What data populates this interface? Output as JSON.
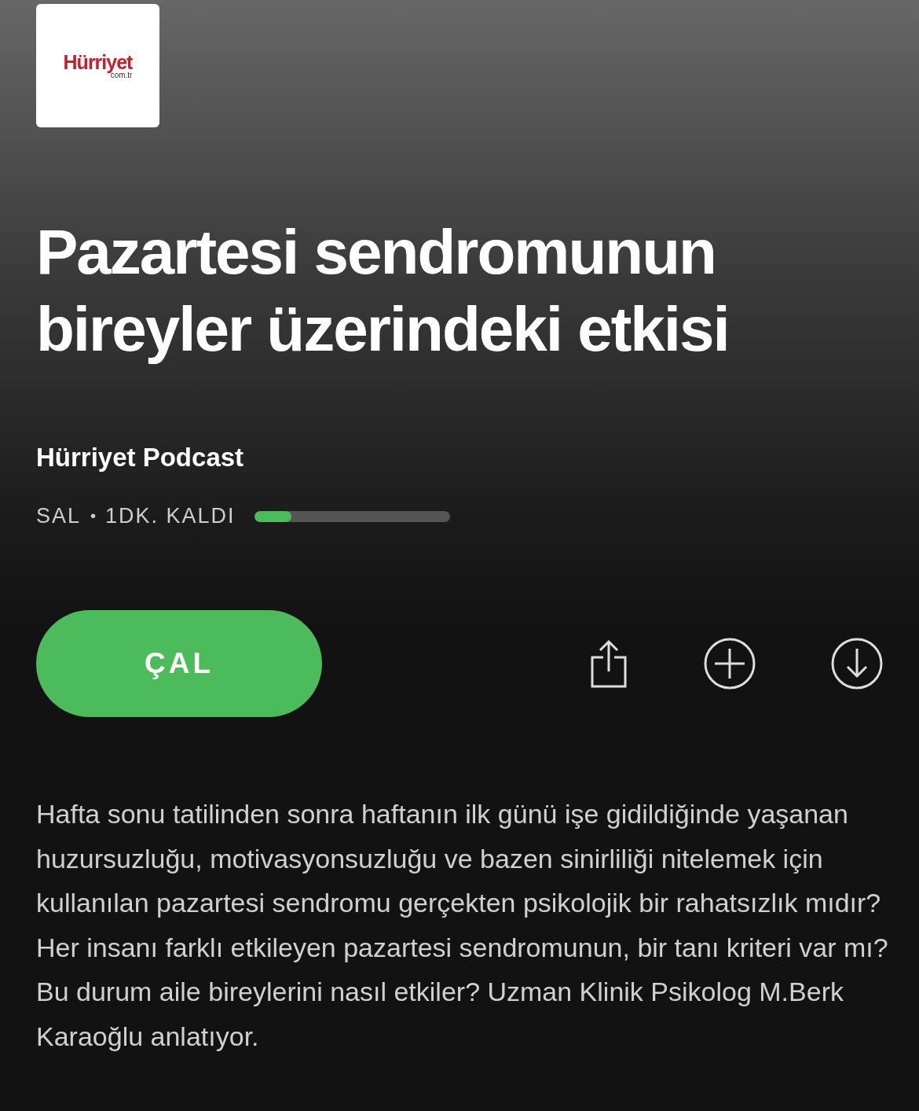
{
  "logo": {
    "name": "Hürriyet",
    "domain": "com.tr"
  },
  "episode": {
    "title": "Pazartesi sendromunun bireyler üzerindeki etkisi",
    "show": "Hürriyet Podcast",
    "day": "SAL",
    "separator": "•",
    "remaining": "1DK. KALDI",
    "progress": {
      "level": 0.19
    }
  },
  "play_button": {
    "label": "ÇAL"
  },
  "description": "Hafta sonu tatilinden sonra haftanın ilk günü işe gidildiğinde yaşanan huzursuzluğu, motivasyonsuzluğu ve bazen sinirliliği nitelemek için kullanılan pazartesi sendromu gerçekten psikolojik bir rahatsızlık mıdır? Her insanı farklı etkileyen pazartesi sendromunun, bir tanı kriteri var mı? Bu durum aile bireylerini nasıl etkiler? Uzman Klinik Psikolog M.Berk Karaoğlu anlatıyor."
}
